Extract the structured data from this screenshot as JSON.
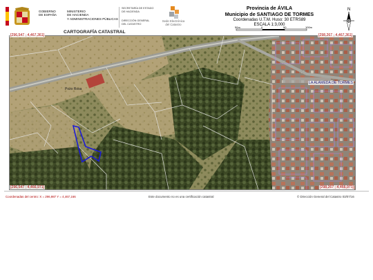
{
  "header": {
    "gov_text": "GOBIERNO\nDE ESPAÑA",
    "ministry_text": "MINISTERIO\nDE HACIENDA\nY ADMINISTRACIONES PÚBLICAS",
    "secretaria_text": "SECRETARÍA DE ESTADO\nDE HACIENDA",
    "direccion_text": "DIRECCIÓN GENERAL\nDEL CATASTRO",
    "sede_text": "Sede Electrónica\ndel Catastro"
  },
  "title_block": {
    "province": "Provincia de ÁVILA",
    "municipality": "Municipio de SANTIAGO DE TORMES",
    "utm": "Coordenadas U.T.M. Huso: 30 ETRS89",
    "scale": "ESCALA 1:3,000",
    "scalebar_labels": [
      "50m",
      "0",
      "50",
      "100m"
    ]
  },
  "north_label": "N",
  "map": {
    "heading": "CARTOGRAFÍA CATASTRAL",
    "coords": {
      "top_left": "[296,547 ; 4,467,361]",
      "top_right": "[298,267 ; 4,467,361]",
      "bottom_left": "[296,547 ; 4,466,971]",
      "bottom_right": "[298,267 ; 4,466,971]"
    },
    "place_labels": {
      "alameda": "LA ALAMEDA DE TORMES",
      "pozo": "Pozo Rosa"
    },
    "colors": {
      "parcel_highlight": "#1b1bd6",
      "cadastral_lines": "#e8e8e8",
      "urban_lines": "#b084e8",
      "coordinate_text": "#b00000"
    }
  },
  "footer": {
    "left": "Coordenadas del centro: X = 296,987 Y = 4,467,166",
    "center": "Este documento no es una certificación catastral",
    "right": "© Dirección General del Catastro 03/07/16"
  }
}
